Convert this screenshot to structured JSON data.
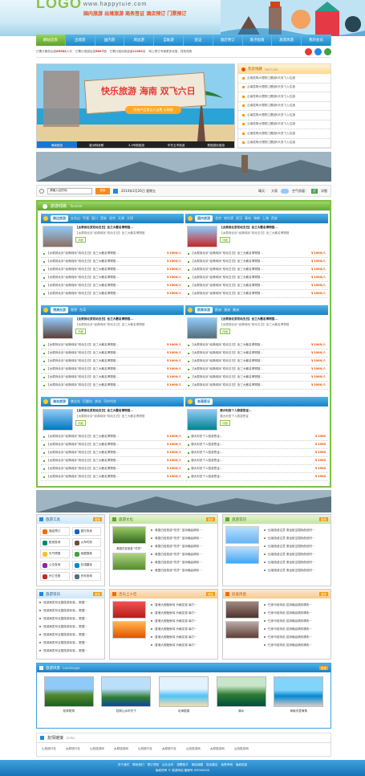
{
  "header": {
    "logo": "LOGO",
    "url": "www.happytuie.com",
    "slogan": "国内旅游 出境旅游 商务签证 酒店预订 门票预订"
  },
  "nav": [
    "網站首頁",
    "出境游",
    "国内游",
    "周边游",
    "自助游",
    "签证",
    "酒店预订",
    "景点指南",
    "旅游风景",
    "我的会员"
  ],
  "notice": {
    "items": [
      {
        "pre": "已累计服务出游",
        "num": "65585",
        "post": "人次"
      },
      {
        "pre": "已累计成团出游",
        "num": "5897",
        "post": "团"
      },
      {
        "pre": "已累计接待旅游者",
        "num": "21563",
        "post": "名"
      }
    ],
    "tail": "网上预订专家更多优惠，快来抢购"
  },
  "banner": {
    "title": "快乐旅游 海南 双飞六日",
    "sub": "所有产品保证天自费 无购物",
    "tabs": [
      "海南旅游",
      "欧洲特卖歌",
      "3-4号新旅游",
      "华东五市旅游",
      "泰国游玩旅游"
    ]
  },
  "hotline": {
    "title": "热卖线路",
    "en": "Hot Line",
    "items": [
      "云南昆明大理丽江跟团6天双飞入住酒",
      "云南昆明大理丽江跟团6天双飞入住酒",
      "云南昆明大理丽江跟团6天双飞入住酒",
      "云南昆明大理丽江跟团6天双飞入住酒",
      "云南昆明大理丽江跟团6天双飞入住酒",
      "云南昆明大理丽江跟团6天双飞入住酒",
      "云南昆明大理丽江跟团6天双飞入住酒",
      "云南昆明大理丽江跟团6天双飞入住酒"
    ]
  },
  "search": {
    "placeholder": "请输入目的地",
    "button": "搜索",
    "date": "2014年2月26日 星期五",
    "weather_city": "晴天：",
    "weather_val": "大雨",
    "air": "空气质量：",
    "air_val": "优",
    "detail": "详细"
  },
  "tourism": {
    "title": "旅游线路",
    "en": "Tourism",
    "blocks": [
      {
        "title": "周边旅游",
        "tags": [
          "五台山",
          "平遥",
          "壶口",
          "西安",
          "北京",
          "天津",
          "大同"
        ],
        "feat_title": "【太原到北京双动五日】含三大著名博物馆…",
        "feat_desc": "【太原到北京“经典纯玩”双动五日】含三大著名博物馆",
        "detail": "详细",
        "rows": [
          {
            "t": "【太原到北京“经典纯玩”双动五日】含三大著名博物馆…",
            "p": "￥1000/人"
          },
          {
            "t": "【太原到北京“经典纯玩”双动五日】含三大著名博物馆…",
            "p": "￥1000/人"
          },
          {
            "t": "【太原到北京“经典纯玩”双动五日】含三大著名博物馆…",
            "p": "￥1000/人"
          },
          {
            "t": "【太原到北京“经典纯玩”双动五日】含三大著名博物馆…",
            "p": "￥1000/人"
          },
          {
            "t": "【太原到北京“经典纯玩”双动五日】含三大著名博物馆…",
            "p": "￥1000/人"
          },
          {
            "t": "【太原到北京“经典纯玩”双动五日】含三大著名博物馆…",
            "p": "￥1000/人"
          }
        ]
      },
      {
        "title": "国内旅游",
        "tags": [
          "北京",
          "哈尔滨",
          "武汉",
          "青岛",
          "海南",
          "上海",
          "西安"
        ],
        "feat_title": "【太原到北京双动五日】含三大著名博物馆…",
        "feat_desc": "【太原到北京“经典纯玩”双动五日】含三大著名博物馆",
        "detail": "详细",
        "rows": [
          {
            "t": "【太原到北京“经典纯玩”双动五日】含三大著名博物馆…",
            "p": "￥1000/人"
          },
          {
            "t": "【太原到北京“经典纯玩”双动五日】含三大著名博物馆…",
            "p": "￥1000/人"
          },
          {
            "t": "【太原到北京“经典纯玩”双动五日】含三大著名博物馆…",
            "p": "￥1000/人"
          },
          {
            "t": "【太原到北京“经典纯玩”双动五日】含三大著名博物馆…",
            "p": "￥1000/人"
          },
          {
            "t": "【太原到北京“经典纯玩”双动五日】含三大著名博物馆…",
            "p": "￥1000/人"
          },
          {
            "t": "【太原到北京“经典纯玩”双动五日】含三大著名博物馆…",
            "p": "￥1000/人"
          }
        ]
      },
      {
        "title": "港澳台游",
        "tags": [
          "香港",
          "台湾"
        ],
        "feat_title": "【太原到北京双动五日】含三大著名博物馆…",
        "feat_desc": "【太原到北京“经典纯玩”双动五日】含三大著名博物馆",
        "detail": "详细",
        "rows": [
          {
            "t": "【太原到北京“经典纯玩”双动五日】含三大著名博物馆…",
            "p": "￥1000/人"
          },
          {
            "t": "【太原到北京“经典纯玩”双动五日】含三大著名博物馆…",
            "p": "￥1000/人"
          },
          {
            "t": "【太原到北京“经典纯玩”双动五日】含三大著名博物馆…",
            "p": "￥1000/人"
          },
          {
            "t": "【太原到北京“经典纯玩”双动五日】含三大著名博物馆…",
            "p": "￥1000/人"
          },
          {
            "t": "【太原到北京“经典纯玩”双动五日】含三大著名博物馆…",
            "p": "￥1000/人"
          },
          {
            "t": "【太原到北京“经典纯玩”双动五日】含三大著名博物馆…",
            "p": "￥1000/人"
          }
        ]
      },
      {
        "title": "欧美非游",
        "tags": [
          "欧洲",
          "澳洲",
          "美洲"
        ],
        "feat_title": "【太原到北京双动五日】含三大著名博物馆…",
        "feat_desc": "【太原到北京“经典纯玩”双动五日】含三大著名博物馆",
        "detail": "详细",
        "rows": [
          {
            "t": "【太原到北京“经典纯玩”双动五日】含三大著名博物馆…",
            "p": "￥1000/人"
          },
          {
            "t": "【太原到北京“经典纯玩”双动五日】含三大著名博物馆…",
            "p": "￥1000/人"
          },
          {
            "t": "【太原到北京“经典纯玩”双动五日】含三大著名博物馆…",
            "p": "￥1000/人"
          },
          {
            "t": "【太原到北京“经典纯玩”双动五日】含三大著名博物馆…",
            "p": "￥1000/人"
          },
          {
            "t": "【太原到北京“经典纯玩”双动五日】含三大著名博物馆…",
            "p": "￥1000/人"
          },
          {
            "t": "【太原到北京“经典纯玩”双动五日】含三大著名博物馆…",
            "p": "￥1000/人"
          }
        ]
      },
      {
        "title": "海岛旅游",
        "tags": [
          "普吉岛",
          "巴厘岛",
          "关岛",
          "马尔代夫"
        ],
        "feat_title": "【太原到北京双动五日】含三大著名博物馆…",
        "feat_desc": "【太原到北京“经典纯玩”双动五日】含三大著名博物馆",
        "detail": "详细",
        "rows": [
          {
            "t": "【太原到北京“经典纯玩”双动五日】含三大著名博物馆…",
            "p": "￥1000/人"
          },
          {
            "t": "【太原到北京“经典纯玩”双动五日】含三大著名博物馆…",
            "p": "￥1000/人"
          },
          {
            "t": "【太原到北京“经典纯玩”双动五日】含三大著名博物馆…",
            "p": "￥1000/人"
          },
          {
            "t": "【太原到北京“经典纯玩”双动五日】含三大著名博物馆…",
            "p": "￥1000/人"
          },
          {
            "t": "【太原到北京“经典纯玩”双动五日】含三大著名博物馆…",
            "p": "￥1000/人"
          },
          {
            "t": "【太原到北京“经典纯玩”双动五日】含三大著名博物馆…",
            "p": "￥1000/人"
          }
        ]
      },
      {
        "title": "各国签证",
        "tags": [],
        "feat_title": "澳大利亚个人旅游签证…",
        "feat_desc": "澳大利亚个人旅游签证",
        "detail": "详细",
        "rows": [
          {
            "t": "澳大利亚个人旅游签证…",
            "p": "￥1500"
          },
          {
            "t": "澳大利亚个人旅游签证…",
            "p": "￥1500"
          },
          {
            "t": "澳大利亚个人旅游签证…",
            "p": "￥1500"
          },
          {
            "t": "澳大利亚个人旅游签证…",
            "p": "￥1500"
          },
          {
            "t": "澳大利亚个人旅游签证…",
            "p": "￥1500"
          },
          {
            "t": "澳大利亚个人旅游签证…",
            "p": "￥1500"
          }
        ]
      }
    ]
  },
  "tools": {
    "title": "旅游工具",
    "more": "更多",
    "items": [
      "酒店预订",
      "银行查询",
      "航班查询",
      "火车时刻",
      "天气预报",
      "地图搜索",
      "公交查询",
      "在线翻译",
      "外汇兑换",
      "列车查询"
    ]
  },
  "news": {
    "title": "旅游资讯",
    "more": "更多",
    "items": [
      "·旅游局发布全国旅游标准... 数据···",
      "·旅游局发布全国旅游标准... 数据···",
      "·旅游局发布全国旅游标准... 数据···",
      "·旅游局发布全国旅游标准... 数据···",
      "·旅游局发布全国旅游标准... 数据···",
      "·旅游局发布全国旅游标准... 数据···",
      "·旅游局发布全国旅游标准... 数据···"
    ]
  },
  "culture": {
    "title": "旅游文化",
    "more": "更多",
    "caption": "美国白宫旅游·“吃货”",
    "items": [
      "·美国白宫旅游“吃货”  招待晚会精彩···",
      "·美国白宫旅游“吃货”  招待晚会精彩···",
      "·美国白宫旅游“吃货”  招待晚会精彩···",
      "·美国白宫旅游“吃货”  招待晚会精彩···",
      "·美国白宫旅游“吃货”  招待晚会精彩···",
      "·美国白宫旅游“吃货”  招待晚会精彩···"
    ]
  },
  "knowledge": {
    "title": "旅游常识",
    "more": "更多",
    "items": [
      "·出境旅游注意 乘坐航空国际航班时···",
      "·出境旅游注意 乘坐航空国际航班时···",
      "·出境旅游注意 乘坐航空国际航班时···",
      "·出境旅游注意 乘坐航空国际航班时···",
      "·出境旅游注意 乘坐航空国际航班时···",
      "·出境旅游注意 乘坐航空国际航班时···"
    ]
  },
  "food": {
    "title": "舌尖上十吃",
    "more": "更多",
    "items": [
      "·香港大赏鲍鱼鸡 价格实惠 每打···",
      "·香港大赏鲍鱼鸡 价格实惠 每打···",
      "·香港大赏鲍鱼鸡 价格实惠 每打···",
      "·香港大赏鲍鱼鸡 价格实惠 每打···",
      "·香港大赏鲍鱼鸡 价格实惠 每打···",
      "·香港大赏鲍鱼鸡 价格实惠 每打···"
    ]
  },
  "customs": {
    "title": "民族风俗",
    "more": "更多",
    "items": [
      "·巴彦马哈特色 招待晚会精彩精彩···",
      "·巴彦马哈特色 招待晚会精彩精彩···",
      "·巴彦马哈特色 招待晚会精彩精彩···",
      "·巴彦马哈特色 招待晚会精彩精彩···",
      "·巴彦马哈特色 招待晚会精彩精彩···",
      "·巴彦马哈特色 招待晚会精彩精彩···"
    ]
  },
  "scenery": {
    "title": "旅游风景",
    "en": "Landscape",
    "more": "更多",
    "items": [
      "桂林阳朔",
      "桂林山水甲天下",
      "北海银滩",
      "漓水",
      "海南天涯海角"
    ]
  },
  "links": {
    "title": "友情链接",
    "en": "Links",
    "items": [
      "山西旅行社",
      "太原旅行社",
      "山西旅游网",
      "太原旅游网",
      "山西旅行社",
      "太原旅行社",
      "山西旅游网",
      "太原旅游网",
      "山西旅游网"
    ]
  },
  "footer": {
    "links": [
      "关于我们",
      "联系我们",
      "预订须知",
      "企业合作",
      "招聘英才",
      "网站地图",
      "投诉建议",
      "免责声明",
      "版权信息"
    ],
    "copy": "版权所有 © 旅游网站 备案号 ICP000000"
  }
}
